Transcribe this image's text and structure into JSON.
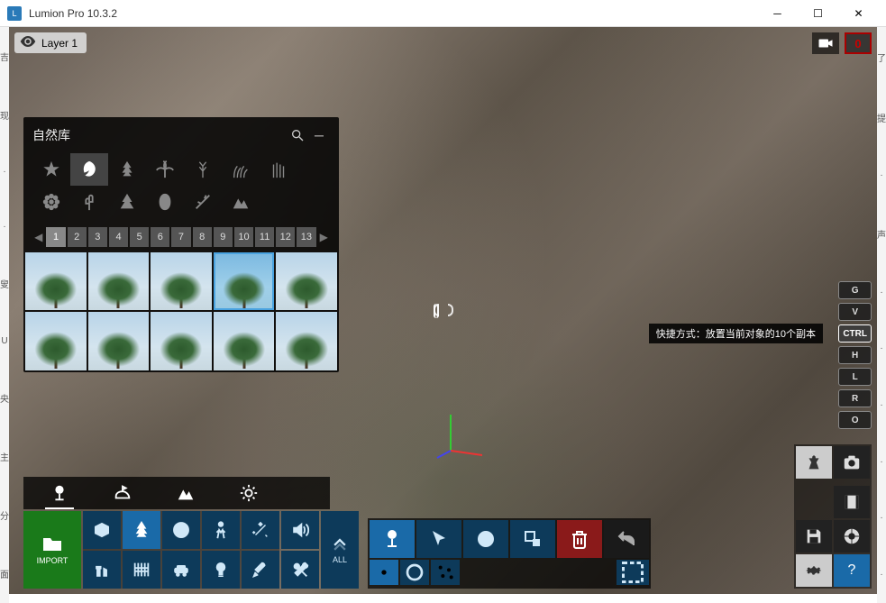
{
  "window": {
    "title": "Lumion Pro 10.3.2"
  },
  "layer": {
    "label": "Layer 1"
  },
  "top_right": {
    "scene_count": "0"
  },
  "library": {
    "title": "自然库",
    "categories": [
      "star",
      "leaf",
      "pine",
      "palm",
      "bare-tree",
      "grass",
      "reed",
      "flower",
      "cactus",
      "bush",
      "leaf2",
      "branch",
      "mountain"
    ],
    "active_category": 1,
    "pages": [
      "1",
      "2",
      "3",
      "4",
      "5",
      "6",
      "7",
      "8",
      "9",
      "10",
      "11",
      "12",
      "13"
    ],
    "selected_thumb": 3
  },
  "tooltip": {
    "text": "快捷方式：放置当前对象的10个副本",
    "key": "CTRL"
  },
  "keys": [
    "G",
    "V",
    "CTRL",
    "H",
    "L",
    "R",
    "O"
  ],
  "active_key": "CTRL",
  "bottom_left": {
    "tabs": [
      "place",
      "paint",
      "terrain",
      "weather"
    ],
    "import_label": "IMPORT",
    "all_label": "ALL"
  },
  "right_panel": {
    "help_label": "?"
  },
  "edge_left": [
    "吉",
    "现",
    "·",
    "·",
    "叟",
    "U",
    "央",
    "主",
    "分",
    "面"
  ],
  "edge_right": [
    "了",
    "提",
    "·",
    "声",
    "·",
    "·",
    "·",
    "·",
    "·",
    "·"
  ]
}
